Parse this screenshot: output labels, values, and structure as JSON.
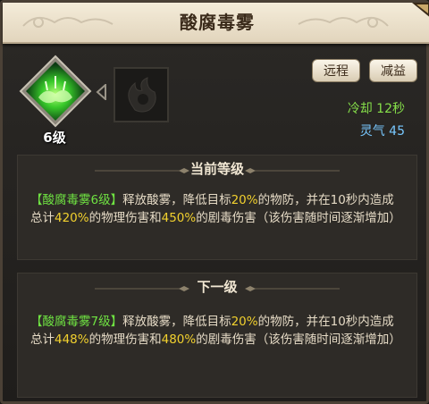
{
  "title": "酸腐毒雾",
  "skill": {
    "level_label": "6级",
    "icon": "green-poison-mist-icon",
    "next_icon": "locked-flame-icon"
  },
  "tags": {
    "range": "远程",
    "debuff": "减益"
  },
  "stats": {
    "cooldown": "冷却 12秒",
    "energy": "灵气 45"
  },
  "current": {
    "header": "当前等级",
    "name": "【酸腐毒雾6级】",
    "t1": "释放酸雾，降低目标",
    "v1": "20%",
    "t2": "的物防，并在10秒内造成总计",
    "v2": "420%",
    "t3": "的物理伤害和",
    "v3": "450%",
    "t4": "的剧毒伤害（该伤害随时间逐渐增加）"
  },
  "next": {
    "header": "下一级",
    "name": "【酸腐毒雾7级】",
    "t1": "释放酸雾，降低目标",
    "v1": "20%",
    "t2": "的物防，并在10秒内造成总计",
    "v2": "448%",
    "t3": "的物理伤害和",
    "v3": "480%",
    "t4": "的剧毒伤害（该伤害随时间逐渐增加）"
  },
  "colors": {
    "skill_name": "#6fe342",
    "value_highlight": "#f2d12e",
    "cooldown": "#86e04a",
    "energy": "#78c8ff"
  }
}
